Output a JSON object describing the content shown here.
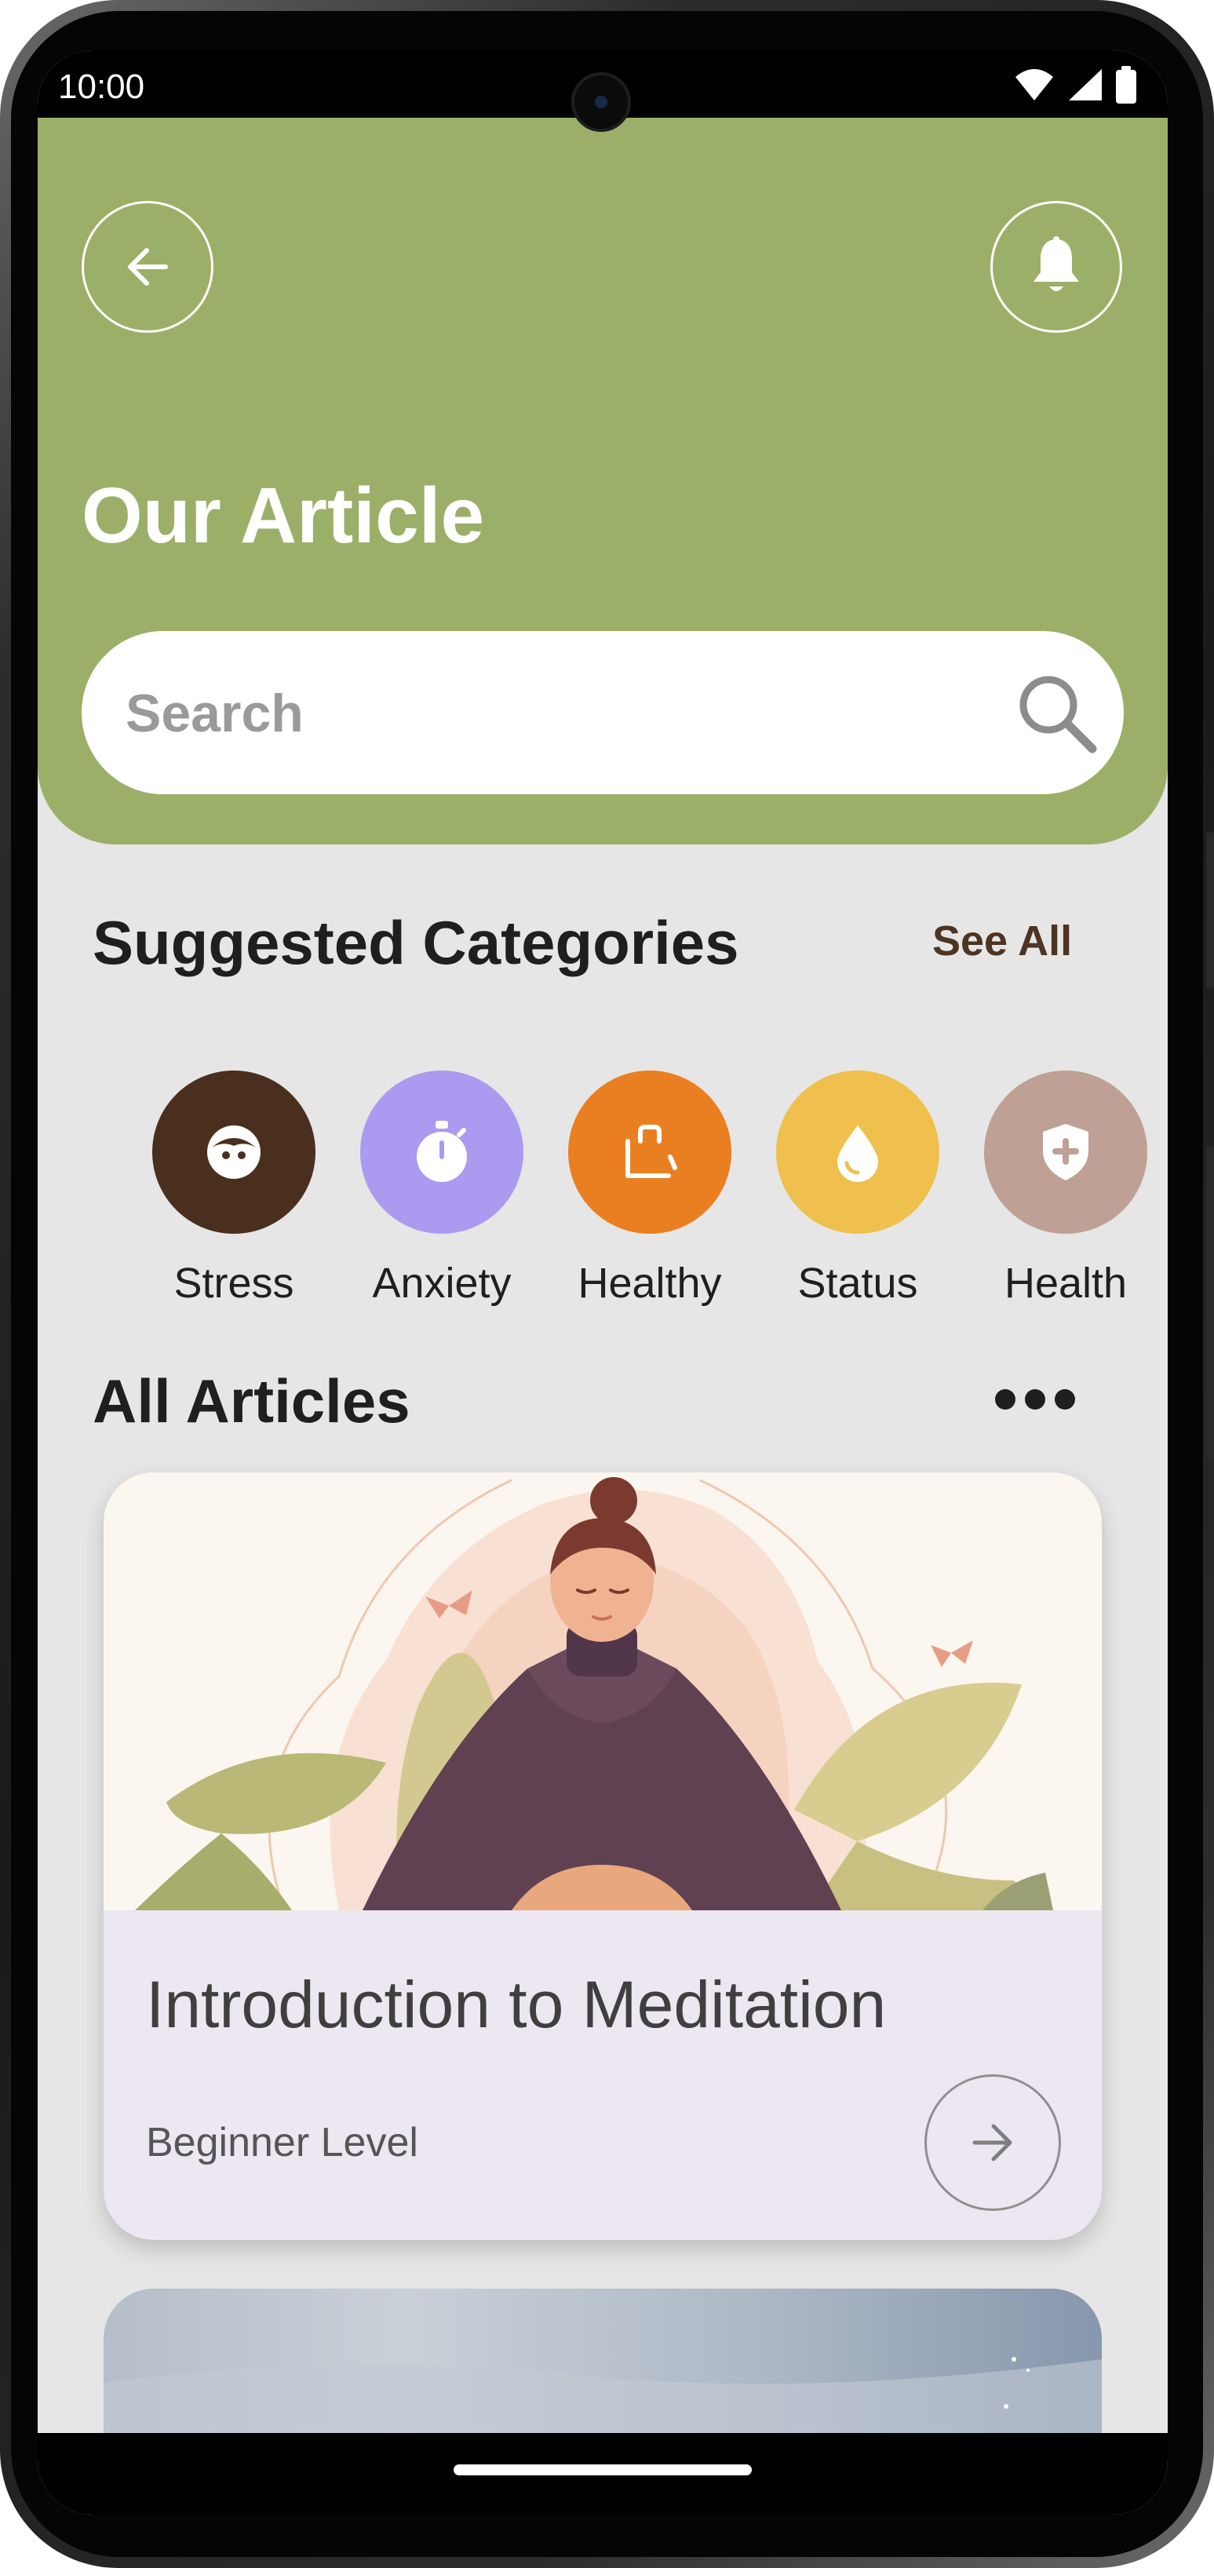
{
  "status_bar": {
    "time": "10:00",
    "icons": [
      "wifi-icon",
      "cellular-signal-icon",
      "battery-icon"
    ]
  },
  "header": {
    "back_icon": "arrow-left-icon",
    "notification_icon": "bell-icon",
    "title": "Our Article",
    "background_color": "#9caf68"
  },
  "search": {
    "placeholder": "Search",
    "icon": "search-icon"
  },
  "suggested_categories": {
    "title": "Suggested Categories",
    "see_all": "See All",
    "items": [
      {
        "label": "Stress",
        "icon": "face-icon",
        "color": "#4a2f1e"
      },
      {
        "label": "Anxiety",
        "icon": "stopwatch-icon",
        "color": "#ac9af0"
      },
      {
        "label": "Healthy",
        "icon": "bag-icon",
        "color": "#ea7f22"
      },
      {
        "label": "Status",
        "icon": "droplet-icon",
        "color": "#efc04e"
      },
      {
        "label": "Health",
        "icon": "shield-plus-icon",
        "color": "#bea194"
      }
    ]
  },
  "all_articles": {
    "title": "All Articles",
    "more_icon": "more-horizontal-icon",
    "cards": [
      {
        "title": "Introduction to Meditation",
        "level": "Beginner Level",
        "image": "meditation-illustration",
        "action_icon": "arrow-right-icon"
      },
      {
        "title": "",
        "level": "",
        "image": "misty-landscape-photo"
      }
    ]
  }
}
